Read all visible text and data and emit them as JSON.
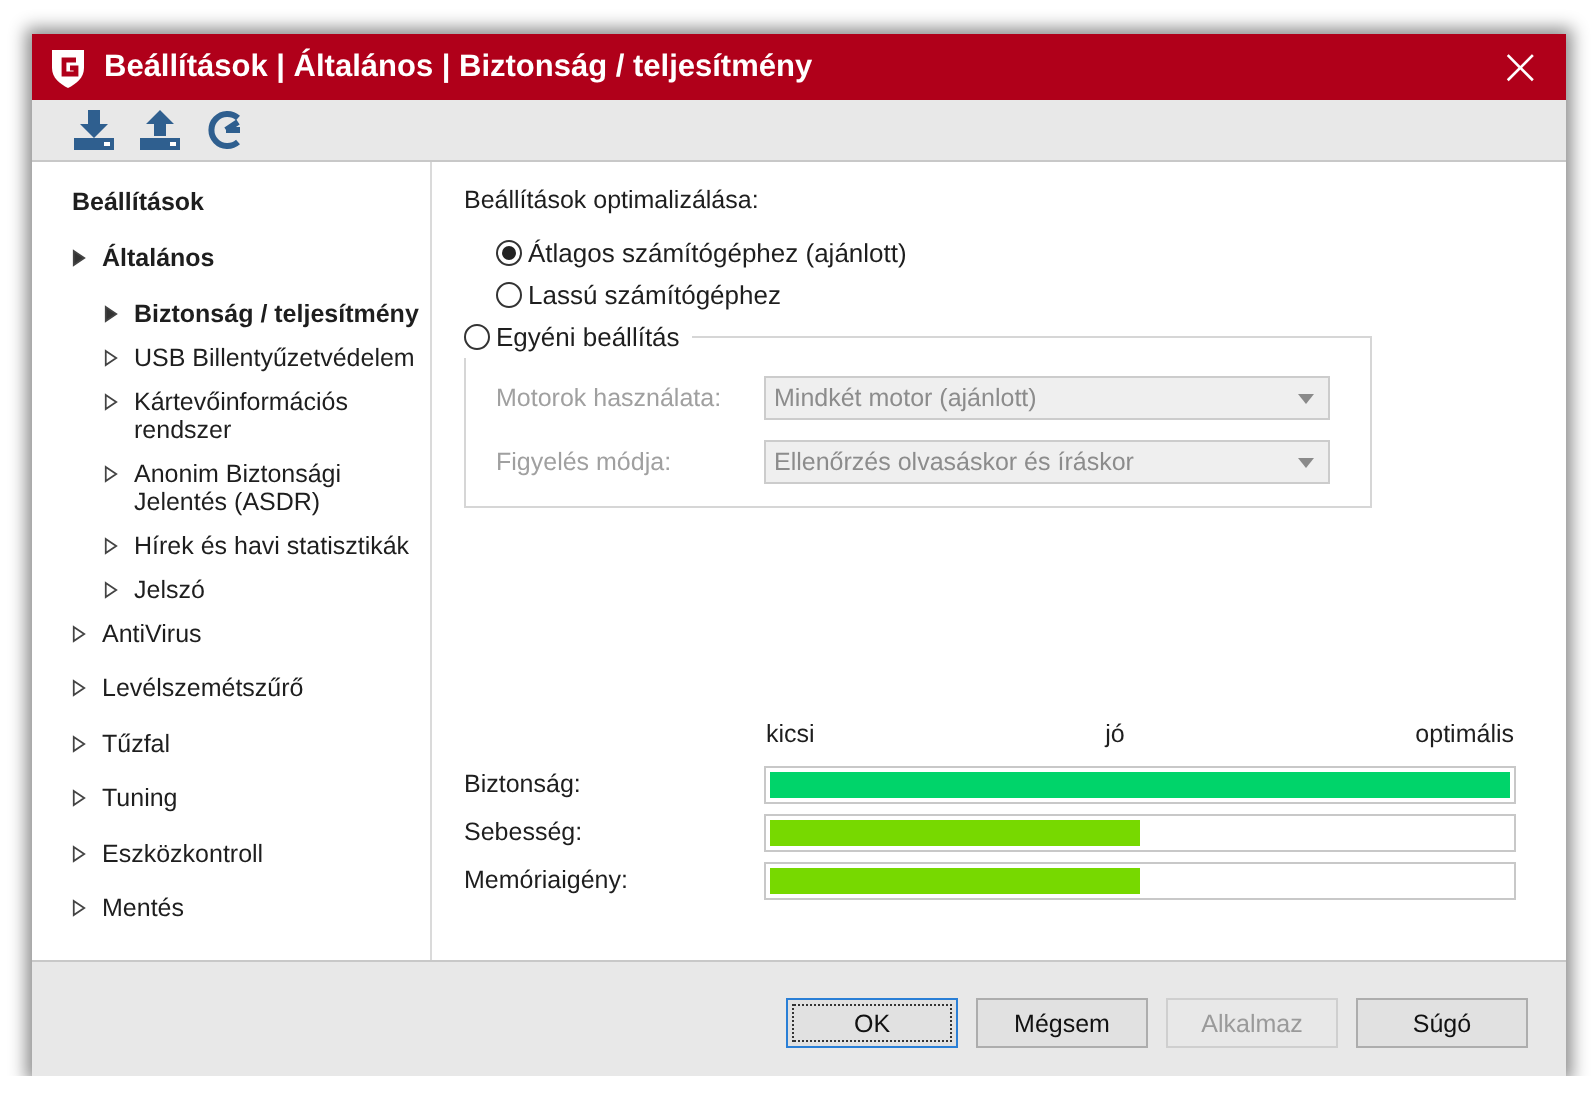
{
  "window": {
    "title": "Beállítások | Általános | Biztonság / teljesítmény",
    "close": "×"
  },
  "sidebar": {
    "heading": "Beállítások",
    "items": [
      {
        "label": "Általános",
        "expanded": true,
        "children": [
          {
            "label": "Biztonság / teljesítmény",
            "selected": true
          },
          {
            "label": "USB Billentyűzetvédelem",
            "selected": false
          },
          {
            "label": "Kártevőinformációs rendszer",
            "selected": false
          },
          {
            "label": "Anonim Biztonsági Jelentés (ASDR)",
            "selected": false
          },
          {
            "label": "Hírek és havi statisztikák",
            "selected": false
          },
          {
            "label": "Jelszó",
            "selected": false
          }
        ]
      },
      {
        "label": "AntiVirus",
        "expanded": false
      },
      {
        "label": "Levélszemétszűrő",
        "expanded": false
      },
      {
        "label": "Tűzfal",
        "expanded": false
      },
      {
        "label": "Tuning",
        "expanded": false
      },
      {
        "label": "Eszközkontroll",
        "expanded": false
      },
      {
        "label": "Mentés",
        "expanded": false
      }
    ]
  },
  "optimization": {
    "heading": "Beállítások optimalizálása:",
    "options": [
      {
        "label": "Átlagos számítógéphez (ajánlott)",
        "selected": true
      },
      {
        "label": "Lassú számítógéphez",
        "selected": false
      },
      {
        "label": "Egyéni beállítás",
        "selected": false
      }
    ],
    "custom": {
      "disabled": true,
      "fields": [
        {
          "label": "Motorok használata:",
          "value": "Mindkét motor (ajánlott)"
        },
        {
          "label": "Figyelés módja:",
          "value": "Ellenőrzés olvasáskor és íráskor"
        }
      ]
    }
  },
  "meters": {
    "scale": [
      "kicsi",
      "jó",
      "optimális"
    ],
    "rows": [
      {
        "name": "Biztonság:",
        "level": 1,
        "color": "#00d46a"
      },
      {
        "name": "Sebesség:",
        "level": 0.5,
        "color": "#77d900"
      },
      {
        "name": "Memóriaigény:",
        "level": 0.5,
        "color": "#77d900"
      }
    ]
  },
  "buttons": [
    {
      "label": "OK",
      "default": true,
      "disabled": false
    },
    {
      "label": "Mégsem",
      "default": false,
      "disabled": false
    },
    {
      "label": "Alkalmaz",
      "default": false,
      "disabled": true
    },
    {
      "label": "Súgó",
      "default": false,
      "disabled": false
    }
  ]
}
